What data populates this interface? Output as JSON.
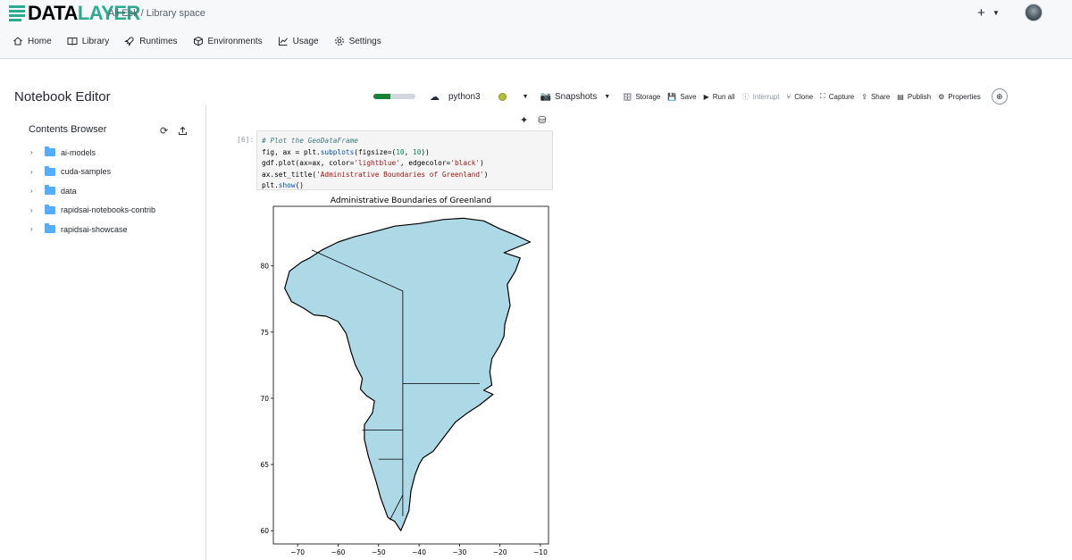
{
  "header": {
    "brand_part1": "DATA",
    "brand_part2": "LAYER",
    "breadcrumb": "Ali Esk / Library space",
    "new_icon": "plus-icon",
    "avatar": "user-avatar"
  },
  "nav": [
    {
      "label": "Home",
      "icon": "home-icon"
    },
    {
      "label": "Library",
      "icon": "book-icon"
    },
    {
      "label": "Runtimes",
      "icon": "rocket-icon"
    },
    {
      "label": "Environments",
      "icon": "cube-icon"
    },
    {
      "label": "Usage",
      "icon": "chart-line-icon"
    },
    {
      "label": "Settings",
      "icon": "gear-icon"
    }
  ],
  "editor": {
    "title": "Notebook Editor",
    "progress": 0.4,
    "kernel": "python3",
    "snapshots": "Snapshots",
    "actions": [
      "Storage",
      "Save",
      "Run all",
      "Interrupt",
      "Clone",
      "Capture",
      "Share",
      "Publish",
      "Properties"
    ]
  },
  "sidebar": {
    "title": "Contents Browser",
    "items": [
      "ai-models",
      "cuda-samples",
      "data",
      "rapidsai-notebooks-contrib",
      "rapidsai-showcase"
    ]
  },
  "cell": {
    "prompt": "[6]:",
    "lines": [
      "# Plot the GeoDataFrame",
      "fig, ax = plt.subplots(figsize=(10, 10))",
      "gdf.plot(ax=ax, color='lightblue', edgecolor='black')",
      "ax.set_title('Administrative Boundaries of Greenland')",
      "plt.show()"
    ]
  },
  "chart_data": {
    "type": "map",
    "title": "Administrative Boundaries of Greenland",
    "xlabel": "",
    "ylabel": "",
    "xticks": [
      -70,
      -60,
      -50,
      -40,
      -30,
      -20,
      -10
    ],
    "yticks": [
      60,
      65,
      70,
      75,
      80
    ],
    "xlim": [
      -76,
      -8
    ],
    "ylim": [
      59,
      84.5
    ],
    "fill_color": "#add8e6",
    "edge_color": "#000000",
    "outline": [
      [
        -73.2,
        78.3
      ],
      [
        -72,
        79.6
      ],
      [
        -69,
        80.3
      ],
      [
        -67,
        80.6
      ],
      [
        -64,
        81.2
      ],
      [
        -60,
        81.8
      ],
      [
        -56,
        82.2
      ],
      [
        -52,
        82.5
      ],
      [
        -46,
        83
      ],
      [
        -40,
        83.2
      ],
      [
        -34,
        83.5
      ],
      [
        -29,
        83.6
      ],
      [
        -24,
        83.4
      ],
      [
        -20,
        82.8
      ],
      [
        -16,
        82.3
      ],
      [
        -12.5,
        81.8
      ],
      [
        -15,
        81.5
      ],
      [
        -19,
        81
      ],
      [
        -15,
        80.6
      ],
      [
        -16.2,
        79.6
      ],
      [
        -18.2,
        78.6
      ],
      [
        -17.5,
        77
      ],
      [
        -18.8,
        75.6
      ],
      [
        -19,
        74.7
      ],
      [
        -20,
        74
      ],
      [
        -22,
        73
      ],
      [
        -22.5,
        72
      ],
      [
        -22,
        71
      ],
      [
        -24,
        70.6
      ],
      [
        -21.7,
        70.3
      ],
      [
        -25,
        69.5
      ],
      [
        -28,
        68.9
      ],
      [
        -31,
        68.2
      ],
      [
        -34,
        67
      ],
      [
        -36.5,
        66
      ],
      [
        -39,
        65.5
      ],
      [
        -40,
        65
      ],
      [
        -41,
        64.2
      ],
      [
        -42,
        63
      ],
      [
        -42.5,
        61.5
      ],
      [
        -43.8,
        60.5
      ],
      [
        -44.5,
        60
      ],
      [
        -46,
        60.7
      ],
      [
        -47.7,
        61
      ],
      [
        -49.5,
        62.5
      ],
      [
        -50.5,
        63.6
      ],
      [
        -51.5,
        64.6
      ],
      [
        -52.5,
        65.6
      ],
      [
        -53.5,
        66.9
      ],
      [
        -53.5,
        68
      ],
      [
        -51.5,
        68.9
      ],
      [
        -51,
        69.8
      ],
      [
        -53,
        70.2
      ],
      [
        -54.5,
        70.7
      ],
      [
        -54,
        71.5
      ],
      [
        -55.7,
        72.5
      ],
      [
        -56.8,
        73.5
      ],
      [
        -58,
        74.9
      ],
      [
        -60,
        75.8
      ],
      [
        -63,
        76.2
      ],
      [
        -66,
        76.3
      ],
      [
        -68.5,
        76.8
      ],
      [
        -71.5,
        77.3
      ],
      [
        -73.2,
        78.3
      ]
    ],
    "regions_lines": [
      [
        [
          -66.5,
          81.2
        ],
        [
          -44,
          78.1
        ],
        [
          -44,
          61.1
        ]
      ],
      [
        [
          -44,
          71.1
        ],
        [
          -25,
          71.1
        ]
      ],
      [
        [
          -54,
          67.6
        ],
        [
          -44,
          67.6
        ]
      ],
      [
        [
          -50,
          65.4
        ],
        [
          -44,
          65.4
        ]
      ],
      [
        [
          -44,
          62.7
        ],
        [
          -47.2,
          60.8
        ]
      ]
    ]
  }
}
